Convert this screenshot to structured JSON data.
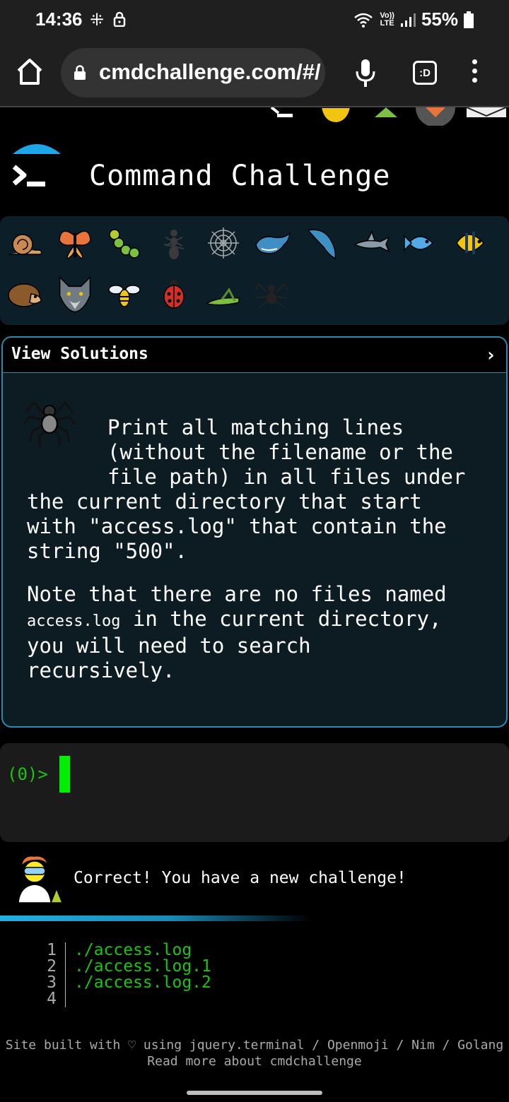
{
  "status_bar": {
    "time": "14:36",
    "lte_top": "Vo))",
    "lte_bottom": "LTE",
    "battery": "55%"
  },
  "browser": {
    "url": "cmdchallenge.com/#/",
    "tab_label": ":D"
  },
  "site": {
    "title": "Command Challenge"
  },
  "badges": [
    "snail-icon",
    "butterfly-icon",
    "caterpillar-icon",
    "ant-icon",
    "spider-web-icon",
    "whale-icon",
    "dolphin-icon",
    "shark-icon",
    "fish-icon",
    "tropical-fish-icon",
    "hedgehog-icon",
    "wolf-icon",
    "bee-icon",
    "ladybug-icon",
    "grasshopper-icon",
    "spider-icon"
  ],
  "solutions": {
    "header": "View Solutions",
    "chevron": "›",
    "challenge_line1": "Print all matching lines",
    "challenge_line2": "(without the filename or the",
    "challenge_line3": "file path) in all files under",
    "challenge_line4": "the current directory that start",
    "challenge_line5": "with \"access.log\" that contain the",
    "challenge_line6": "string \"500\".",
    "note_part1": "Note that there are no files named",
    "note_code": "access.log",
    "note_part2": " in the current directory,",
    "note_part3": "you will need to search",
    "note_part4": "recursively."
  },
  "terminal": {
    "prompt": "(0)>"
  },
  "feedback": {
    "message": "Correct! You have a new challenge!"
  },
  "output": {
    "lines": [
      {
        "num": "1",
        "text": "./access.log"
      },
      {
        "num": "2",
        "text": "./access.log.1"
      },
      {
        "num": "3",
        "text": "./access.log.2"
      },
      {
        "num": "4",
        "text": ""
      }
    ]
  },
  "footer": {
    "line1": "Site built with ♡ using jquery.terminal / Openmoji / Nim / Golang",
    "line2": "Read more about cmdchallenge"
  },
  "colors": {
    "accent": "#2a8bb0",
    "terminal_green": "#19c60b",
    "cursor_green": "#00ee00",
    "badge_bg": "#0c1e27"
  }
}
